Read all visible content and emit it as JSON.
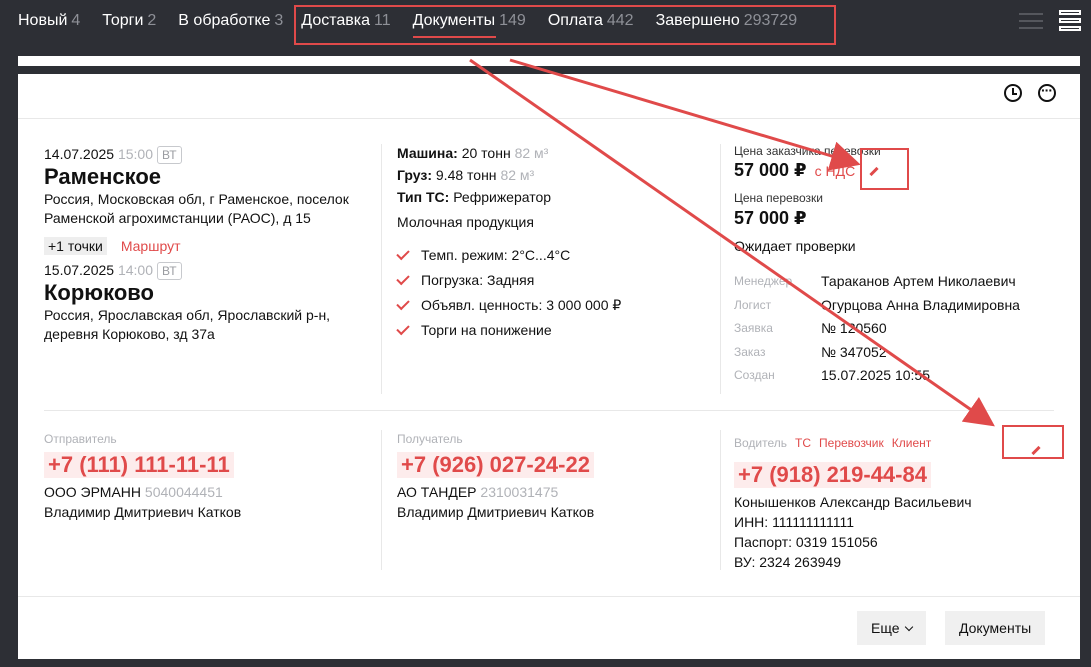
{
  "tabs": [
    {
      "label": "Новый",
      "count": "4"
    },
    {
      "label": "Торги",
      "count": "2"
    },
    {
      "label": "В обработке",
      "count": "3"
    },
    {
      "label": "Доставка",
      "count": "11"
    },
    {
      "label": "Документы",
      "count": "149"
    },
    {
      "label": "Оплата",
      "count": "442"
    },
    {
      "label": "Завершено",
      "count": "293729"
    }
  ],
  "colors": {
    "accent": "#e04a4a",
    "bg": "#2d2f35"
  },
  "route": {
    "from": {
      "date": "14.07.2025",
      "time": "15:00",
      "badge": "ВТ",
      "city": "Раменское",
      "address": "Россия, Московская обл, г Раменское, поселок Раменской агрохимстанции (РАОС), д 15"
    },
    "points_badge": "+1 точки",
    "route_link": "Маршрут",
    "to": {
      "date": "15.07.2025",
      "time": "14:00",
      "badge": "ВТ",
      "city": "Корюково",
      "address": "Россия, Ярославская обл, Ярославский р-н, деревня Корюково, зд 37а"
    }
  },
  "cargo": {
    "machine_label": "Машина:",
    "machine_value": "20 тонн",
    "machine_volume": "82 м³",
    "cargo_label": "Груз:",
    "cargo_value": "9.48 тонн",
    "cargo_volume": "82 м³",
    "type_label": "Тип ТС:",
    "type_value": "Рефрижератор",
    "product": "Молочная продукция",
    "checks": [
      "Темп. режим: 2°C...4°C",
      "Погрузка: Задняя",
      "Объявл. ценность: 3 000 000 ₽",
      "Торги на понижение"
    ]
  },
  "pricing": {
    "customer_price_label": "Цена заказчика перевозки",
    "customer_price": "57 000 ₽",
    "vat_label": "с НДС",
    "carriage_price_label": "Цена перевозки",
    "carriage_price": "57 000 ₽",
    "status": "Ожидает проверки",
    "meta": [
      {
        "k": "Менеджер",
        "v": "Тараканов Артем Николаевич"
      },
      {
        "k": "Логист",
        "v": "Огурцова Анна Владимировна"
      },
      {
        "k": "Заявка",
        "v": "№ 120560"
      },
      {
        "k": "Заказ",
        "v": "№ 347052"
      },
      {
        "k": "Создан",
        "v": "15.07.2025 10:55"
      }
    ]
  },
  "sender": {
    "label": "Отправитель",
    "phone": "+7 (111) 111-11-11",
    "company": "ООО ЭРМАНН",
    "inn": "5040044451",
    "person": "Владимир Дмитриевич Катков"
  },
  "receiver": {
    "label": "Получатель",
    "phone": "+7 (926) 027-24-22",
    "company": "АО ТАНДЕР",
    "inn": "2310031475",
    "person": "Владимир Дмитриевич Катков"
  },
  "driver": {
    "label": "Водитель",
    "links": [
      "ТС",
      "Перевозчик",
      "Клиент"
    ],
    "phone": "+7 (918) 219-44-84",
    "name": "Конышенков Александр Васильевич",
    "inn": "ИНН: 111111111111",
    "passport": "Паспорт: 0319 151056",
    "license": "ВУ: 2324 263949"
  },
  "footer": {
    "more_label": "Еще",
    "documents_label": "Документы"
  }
}
